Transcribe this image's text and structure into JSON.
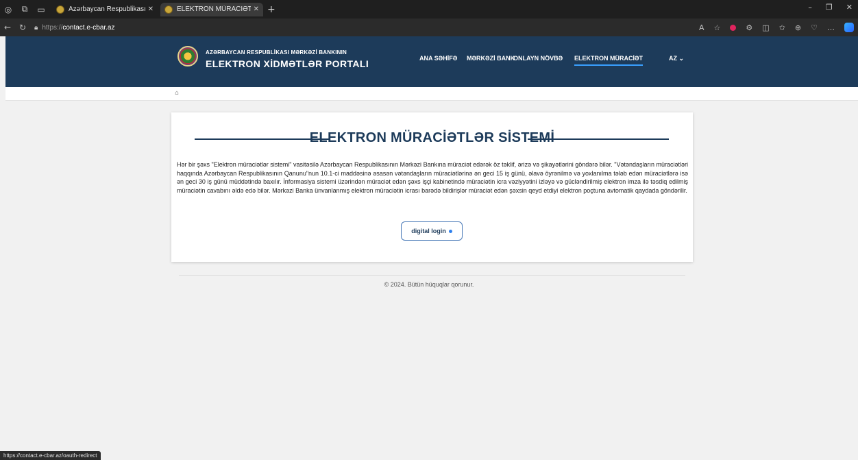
{
  "browser": {
    "tabs": [
      {
        "label": "Azərbaycan Respublikasının Mərk",
        "active": false
      },
      {
        "label": "ELEKTRON MÜRACİƏTLƏR SİSTE",
        "active": true
      }
    ],
    "url_scheme": "https://",
    "url_host": "contact.e-cbar.az",
    "status_url": "https://contact.e-cbar.az/oauth-redirect",
    "icons": [
      "copilot-icon",
      "edge-workspaces-icon",
      "tab-actions-icon",
      "back-icon",
      "refresh-icon",
      "lock-icon",
      "read-aloud-icon",
      "favorite-icon",
      "extensions-icon",
      "split-screen-icon",
      "favorites-bar-icon",
      "collections-icon",
      "more-icon",
      "minimize-icon",
      "restore-icon",
      "close-icon"
    ]
  },
  "header": {
    "brand_top": "AZƏRBAYCAN RESPUBLİKASI MƏRKƏZİ BANKININ",
    "brand_main": "ELEKTRON XİDMƏTLƏR PORTALI",
    "nav": [
      {
        "label": "ANA SƏHİFƏ",
        "active": false
      },
      {
        "label": "MƏRKƏZİ BANK",
        "active": false
      },
      {
        "label": "ONLAYN NÖVBƏ",
        "active": false
      },
      {
        "label": "ELEKTRON MÜRACİƏT",
        "active": true
      }
    ],
    "lang": "AZ ⌄",
    "accent_color": "#1d3b5a"
  },
  "main": {
    "title": "ELEKTRON MÜRACİƏTLƏR SİSTEMİ",
    "description": "Hər bir şəxs \"Elektron müraciətlər sistemi\" vasitəsilə Azərbaycan Respublikasının Mərkəzi Bankına müraciət edərək öz təklif, ərizə və şikayətlərini göndərə bilər. \"Vətəndaşların müraciətləri haqqında Azərbaycan Respublikasının Qanunu\"nun 10.1-ci maddəsinə əsasən vətəndaşların müraciətlərinə ən geci 15 iş günü, əlavə öyrənilmə və yoxlanılma tələb edən müraciətlərə isə ən geci 30 iş günü müddətində baxılır. İnformasiya sistemi üzərindən müraciət edən şəxs işçi kabinetində müraciətin icra vəziyyətini izləyə və gücləndirilmiş elektron imza ilə təsdiq edilmiş müraciətin cavabını əldə edə bilər. Mərkəzi Banka ünvanlanmış elektron müraciətin icrası barədə bildirişlər müraciət edən şəxsin qeyd etdiyi elektron poçtuna avtomatik qaydada göndərilir.",
    "login_button": "digital login"
  },
  "footer": {
    "copyright": "© 2024. Bütün hüquqlar qorunur."
  }
}
